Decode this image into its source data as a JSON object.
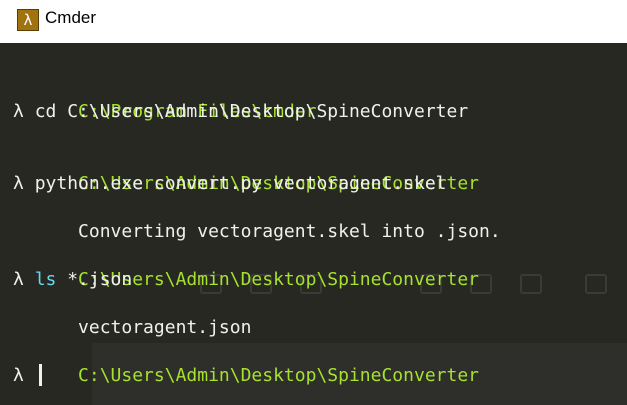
{
  "window": {
    "title": "Cmder",
    "icon_glyph": "λ"
  },
  "terminal": {
    "colors": {
      "background": "#272822",
      "path": "#a6e22e",
      "text": "#f0f0f0",
      "ls_command": "#66d9ef"
    },
    "line1_path": "C:\\Program Files\\cmder",
    "line2_prompt": "λ ",
    "line2_cmd": "cd C:\\Users\\Admin\\Desktop\\SpineConverter",
    "line3_path": "C:\\Users\\Admin\\Desktop\\SpineConverter",
    "line4_prompt": "λ ",
    "line4_cmd": "python.exe convert.py vectoragent.skel",
    "line5_output": "Converting vectoragent.skel into .json.",
    "line6_path": "C:\\Users\\Admin\\Desktop\\SpineConverter",
    "line7_prompt": "λ ",
    "line7_ls": "ls",
    "line7_arg": " *.json",
    "line8_output": "vectoragent.json",
    "line9_path": "C:\\Users\\Admin\\Desktop\\SpineConverter",
    "line10_prompt": "λ "
  }
}
